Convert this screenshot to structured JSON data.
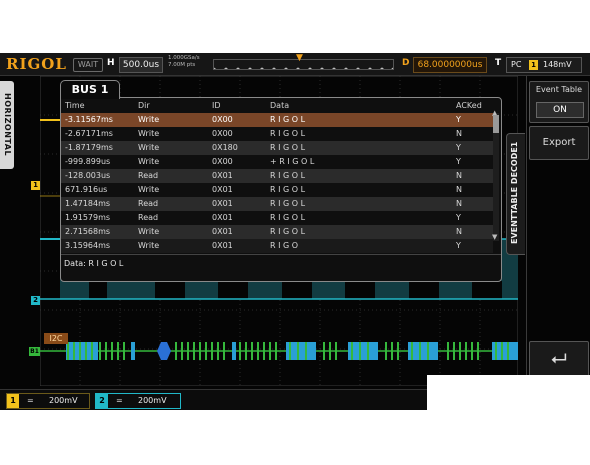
{
  "header": {
    "logo": "RIGOL",
    "run_status": "WAIT",
    "horizontal_label": "H",
    "timebase": "500.0us",
    "sample_rate": "1.000GSa/s",
    "memory_depth": "7.00M pts",
    "delay_label": "D",
    "delay_value": "68.0000000us",
    "trigger_label": "T",
    "trigger_type": "PC",
    "trigger_channel": "1",
    "trigger_level": "148mV"
  },
  "side": {
    "horizontal_tab": "HORIZONTAL",
    "ch1_marker": "1",
    "ch2_marker": "2",
    "bus_marker": "B1"
  },
  "bus_tab": "BUS 1",
  "table": {
    "headers": [
      "Time",
      "Dir",
      "ID",
      "Data",
      "ACKed"
    ],
    "rows": [
      [
        "-3.11567ms",
        "Write",
        "0X00",
        "R I G O L",
        "Y"
      ],
      [
        "-2.67171ms",
        "Write",
        "0X00",
        "R I G O L",
        "N"
      ],
      [
        "-1.87179ms",
        "Write",
        "0X180",
        "R I G O L",
        "Y"
      ],
      [
        "-999.899us",
        "Write",
        "0X00",
        "+ R I G O L",
        "Y"
      ],
      [
        "-128.003us",
        "Read",
        "0X01",
        "R I G O L",
        "N"
      ],
      [
        "671.916us",
        "Write",
        "0X01",
        "R I G O L",
        "N"
      ],
      [
        "1.47184ms",
        "Read",
        "0X01",
        "R I G O L",
        "N"
      ],
      [
        "1.91579ms",
        "Read",
        "0X01",
        "R I G O L",
        "Y"
      ],
      [
        "2.71568ms",
        "Write",
        "0X01",
        "R I G O L",
        "N"
      ],
      [
        "3.15964ms",
        "Write",
        "0X01",
        "R I G O",
        "Y"
      ]
    ],
    "detail": "Data: R I G O L"
  },
  "menu": {
    "decode_tab": "EVENTTABLE  DECODE1",
    "event_table_label": "Event Table",
    "event_table_value": "ON",
    "export_label": "Export",
    "back_label": "⮠"
  },
  "protocol_label": "I2C",
  "channels": {
    "ch1": {
      "num": "1",
      "coupling": "=",
      "scale": "200mV"
    },
    "ch2": {
      "num": "2",
      "coupling": "=",
      "scale": "200mV"
    }
  },
  "colors": {
    "ch1": "#f2c21c",
    "ch2": "#21b8c8",
    "bus_scl": "#2a9fd6",
    "bus_sda": "#35b83c",
    "accent": "#f2a21c"
  }
}
